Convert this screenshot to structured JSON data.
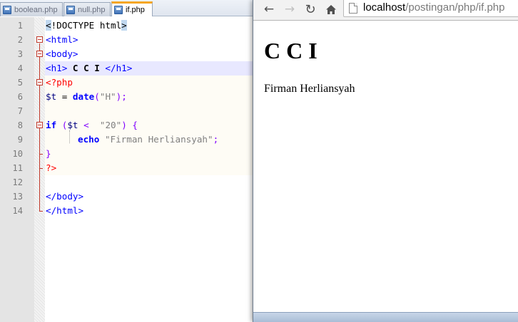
{
  "editor": {
    "tabs": [
      {
        "label": "boolean.php",
        "active": false
      },
      {
        "label": "null.php",
        "active": false
      },
      {
        "label": "if.php",
        "active": true
      }
    ],
    "line_numbers": [
      "1",
      "2",
      "3",
      "4",
      "5",
      "6",
      "7",
      "8",
      "9",
      "10",
      "11",
      "12",
      "13",
      "14"
    ],
    "lines": {
      "l1a": "<",
      "l1b": "!DOCTYPE html",
      "l1c": ">",
      "l2": "<html>",
      "l3": "<body>",
      "l4a": "<h1>",
      "l4b": " C C I ",
      "l4c": "</h1>",
      "l5": "<?php",
      "l6a": "$t",
      "l6b": " = ",
      "l6c": "date",
      "l6d": "(",
      "l6e": "\"H\"",
      "l6f": ");",
      "l8a": "if",
      "l8b": " (",
      "l8c": "$t",
      "l8d": " <  ",
      "l8e": "\"20\"",
      "l8f": ") {",
      "l9a": "echo",
      "l9b": " ",
      "l9c": "\"Firman Herliansyah\"",
      "l9d": ";",
      "l10": "}",
      "l11": "?>",
      "l13": "</body>",
      "l14": "</html>"
    }
  },
  "browser": {
    "url_host": "localhost",
    "url_path": "/postingan/php/if.php",
    "page_heading": "C C I",
    "page_text": "Firman Herliansyah"
  },
  "colors": {
    "accent_tab": "#f5a623",
    "html_tag": "#0000ff",
    "php_delim": "#ff0000",
    "string": "#808080",
    "current_line": "#e8e8ff"
  }
}
